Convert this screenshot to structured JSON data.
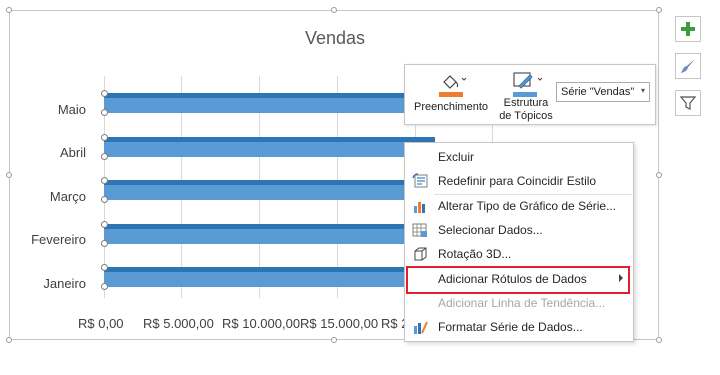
{
  "chart": {
    "title": "Vendas",
    "categories": [
      "Maio",
      "Abril",
      "Março",
      "Fevereiro",
      "Janeiro"
    ],
    "x_tick_labels": [
      "R$ 0,00",
      "R$ 5.000,00",
      "R$ 10.000,00",
      "R$ 15.000,00",
      "R$ 2"
    ]
  },
  "chart_data": {
    "type": "bar",
    "orientation": "horizontal",
    "title": "Vendas",
    "categories": [
      "Janeiro",
      "Fevereiro",
      "Março",
      "Abril",
      "Maio"
    ],
    "values": [
      21000,
      21500,
      21200,
      21300,
      21000
    ],
    "xlim": [
      0,
      25000
    ],
    "grid": true,
    "color": "#5b9bd5"
  },
  "side_buttons": [
    {
      "icon": "plus-icon",
      "color": "#3c9b3c"
    },
    {
      "icon": "brush-icon",
      "color": "#3a6fb5"
    },
    {
      "icon": "filter-icon",
      "color": "#555555"
    }
  ],
  "mini_toolbar": {
    "fill_label": "Preenchimento",
    "outline_label_line1": "Estrutura",
    "outline_label_line2": "de Tópicos",
    "series_value": "Série \"Vendas\"",
    "fill_color": "#ed7d31",
    "outline_color": "#5b9bd5"
  },
  "context_menu": {
    "items": [
      {
        "label": "Excluir",
        "icon": "",
        "disabled": false
      },
      {
        "label": "Redefinir para Coincidir Estilo",
        "icon": "reset-style-icon",
        "disabled": false
      },
      {
        "label": "Alterar Tipo de Gráfico de Série...",
        "icon": "chart-type-icon",
        "disabled": false
      },
      {
        "label": "Selecionar Dados...",
        "icon": "select-data-icon",
        "disabled": false
      },
      {
        "label": "Rotação 3D...",
        "icon": "rotation-3d-icon",
        "disabled": false
      },
      {
        "label": "Adicionar Rótulos de Dados",
        "icon": "",
        "disabled": false,
        "submenu": true
      },
      {
        "label": "Adicionar Linha de Tendência...",
        "icon": "",
        "disabled": true
      },
      {
        "label": "Formatar Série de Dados...",
        "icon": "format-series-icon",
        "disabled": false
      }
    ],
    "highlight_color": "#e0202e"
  }
}
